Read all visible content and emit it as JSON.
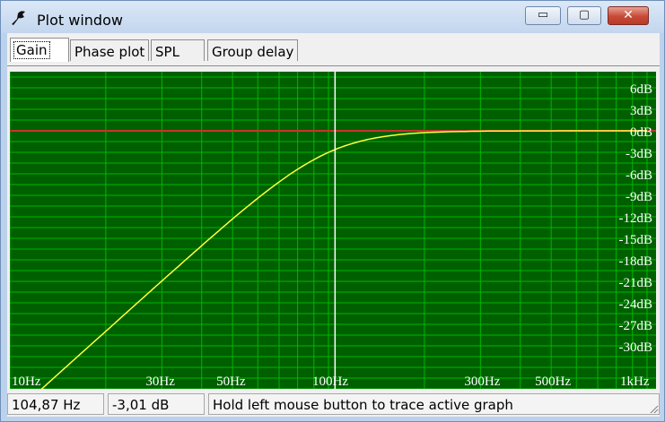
{
  "window": {
    "title": "Plot window",
    "controls": {
      "minimize": "▭",
      "maximize": "▢",
      "close": "✕"
    }
  },
  "tabs": [
    "Gain",
    "Phase plot",
    "SPL",
    "Group delay"
  ],
  "active_tab": 0,
  "plot": {
    "x_labels": [
      "10Hz",
      "30Hz",
      "50Hz",
      "100Hz",
      "300Hz",
      "500Hz",
      "1kHz"
    ],
    "y_labels": [
      "6dB",
      "3dB",
      "0dB",
      "-3dB",
      "-6dB",
      "-9dB",
      "-12dB",
      "-15dB",
      "-18dB",
      "-21dB",
      "-24dB",
      "-27dB",
      "-30dB"
    ],
    "colors": {
      "background": "#006000",
      "grid": "#00c800",
      "trace": "#ffff40",
      "zero_line": "#c83232",
      "cursor": "#ffffff",
      "label_text": "#ffffff"
    }
  },
  "status": {
    "frequency": "104,87 Hz",
    "level": "-3,01 dB",
    "hint": "Hold left mouse button to trace active graph"
  }
}
